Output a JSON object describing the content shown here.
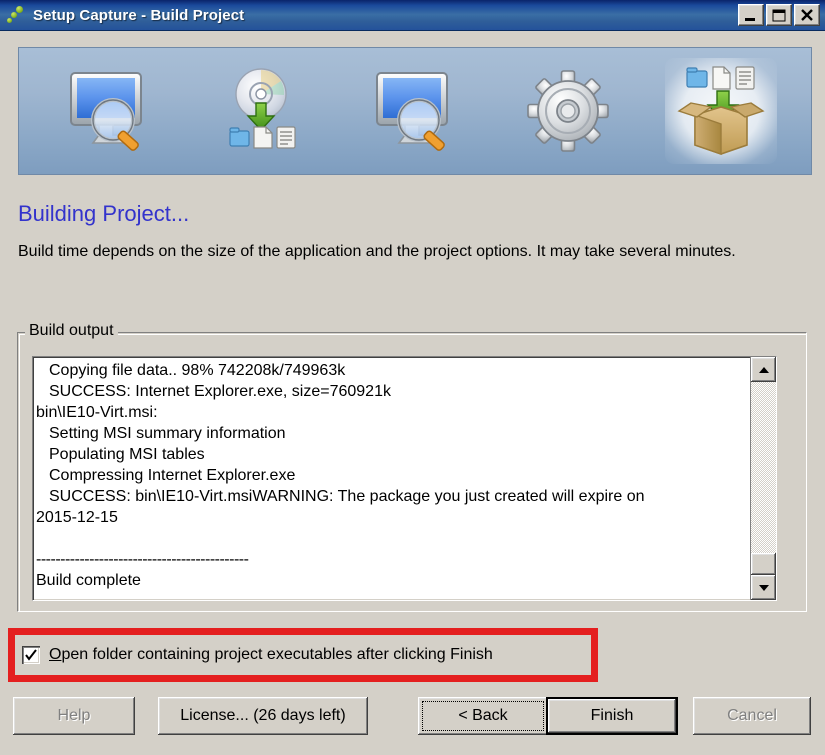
{
  "window": {
    "title": "Setup Capture - Build Project",
    "icon": "app-bubbles-icon",
    "controls": {
      "minimize": "minimize-icon",
      "maximize": "maximize-icon",
      "close": "close-icon"
    }
  },
  "banner": {
    "steps": [
      {
        "id": "scan-before",
        "icon": "monitor-magnifier-icon",
        "active": false
      },
      {
        "id": "install",
        "icon": "disc-download-icon",
        "active": false
      },
      {
        "id": "scan-after",
        "icon": "monitor-magnifier-icon",
        "active": false
      },
      {
        "id": "configure",
        "icon": "gear-icon",
        "active": false
      },
      {
        "id": "build",
        "icon": "package-box-icon",
        "active": true
      }
    ]
  },
  "page": {
    "heading": "Building Project...",
    "description": "Build time depends on the size of the application and the project options. It may take several minutes."
  },
  "build_output": {
    "group_label": "Build output",
    "lines": [
      {
        "text": "Copying file data.. 98% 742208k/749963k",
        "indent": true
      },
      {
        "text": "SUCCESS: Internet Explorer.exe, size=760921k",
        "indent": true
      },
      {
        "text": "bin\\IE10-Virt.msi:",
        "indent": false
      },
      {
        "text": "Setting MSI summary information",
        "indent": true
      },
      {
        "text": "Populating MSI tables",
        "indent": true
      },
      {
        "text": "Compressing Internet Explorer.exe",
        "indent": true
      },
      {
        "text": "SUCCESS: bin\\IE10-Virt.msiWARNING: The package you just created will expire on",
        "indent": true
      },
      {
        "text": "2015-12-15",
        "indent": false
      },
      {
        "text": "",
        "indent": false
      },
      {
        "text": "--------------------------------------------",
        "indent": false
      },
      {
        "text": "Build complete",
        "indent": false
      }
    ],
    "scrollbar": {
      "up_arrow": "scroll-up-icon",
      "down_arrow": "scroll-down-icon",
      "thumb_position": "bottom"
    }
  },
  "options": {
    "open_folder": {
      "label_prefix": "",
      "accel": "O",
      "label": "pen folder containing project executables after clicking Finish",
      "full_label": "Open folder containing project executables after clicking Finish",
      "checked": true
    },
    "highlight_color": "#e41f1f"
  },
  "buttons": {
    "help": {
      "label": "Help",
      "accel": "H",
      "enabled": false,
      "default": false,
      "focused": false
    },
    "license": {
      "label": "License... (26 days left)",
      "accel": "L",
      "enabled": true,
      "default": false,
      "focused": false
    },
    "back": {
      "label": "< Back",
      "accel": "B",
      "enabled": true,
      "default": false,
      "focused": true
    },
    "finish": {
      "label": "Finish",
      "accel": "",
      "enabled": true,
      "default": true,
      "focused": false
    },
    "cancel": {
      "label": "Cancel",
      "accel": "",
      "enabled": false,
      "default": false,
      "focused": false
    }
  },
  "colors": {
    "titlebar_start": "#0a246a",
    "titlebar_end": "#2a5699",
    "dialog_face": "#d4d0c8",
    "banner_bg": "#93abc8",
    "heading_blue": "#3333cc",
    "highlight_red": "#e41f1f"
  }
}
